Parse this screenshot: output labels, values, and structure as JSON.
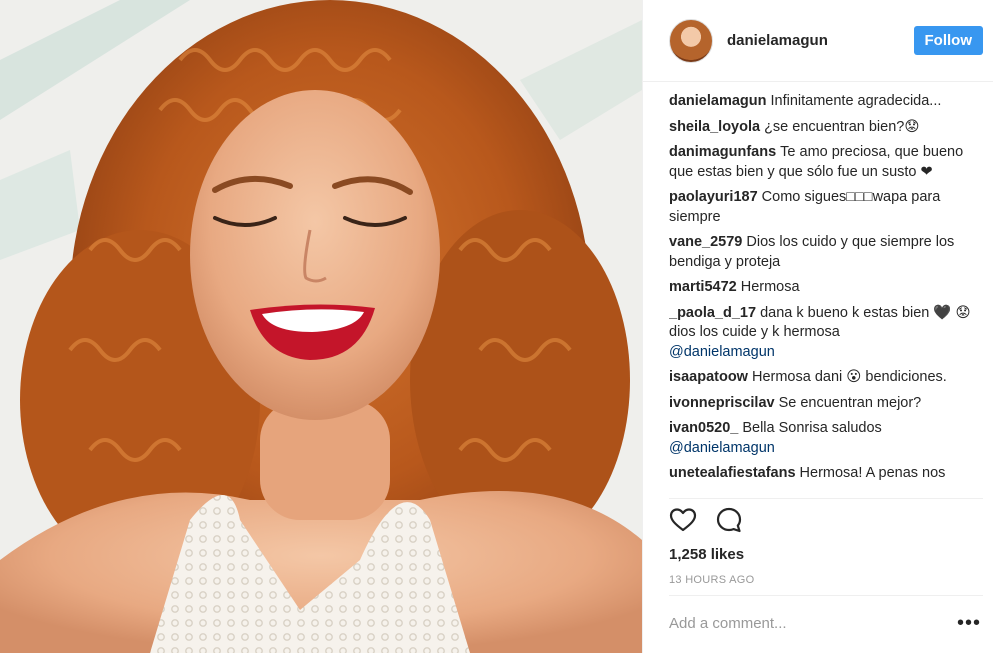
{
  "post": {
    "photo_alt": "smiling woman with curly red hair",
    "header": {
      "username": "danielamagun",
      "follow_label": "Follow"
    },
    "comments": [
      {
        "user": "danielamagun",
        "text": "Infinitamente agradecida..."
      },
      {
        "user": "sheila_loyola",
        "text": "¿se encuentran bien?😟"
      },
      {
        "user": "danimagunfans",
        "text": "Te amo preciosa, que bueno que estas bien y que sólo fue un susto ❤"
      },
      {
        "user": "paolayuri187",
        "text": "Como sigues□□□wapa para siempre"
      },
      {
        "user": "vane_2579",
        "text": "Dios los cuido y que siempre los bendiga y proteja"
      },
      {
        "user": "marti5472",
        "text": "Hermosa"
      },
      {
        "user": "_paola_d_17",
        "text": "dana k bueno k estas bien 🖤 😟 dios los cuide y k hermosa",
        "mention": "@danielamagun"
      },
      {
        "user": "isaapatoow",
        "text": "Hermosa dani 😮 bendiciones."
      },
      {
        "user": "ivonnepriscilav",
        "text": "Se encuentran mejor?"
      },
      {
        "user": "ivan0520_",
        "text": "Bella Sonrisa saludos",
        "mention": "@danielamagun"
      },
      {
        "user": "unetealafiestafans",
        "text": "Hermosa! A penas nos"
      }
    ],
    "likes": "1,258 likes",
    "time": "13 HOURS AGO",
    "add_comment_placeholder": "Add a comment...",
    "more_label": "•••",
    "icons": {
      "like": "heart-icon",
      "comment": "speech-bubble-icon"
    },
    "colors": {
      "follow": "#3897f0",
      "mention": "#003569",
      "meta": "#999999"
    }
  }
}
